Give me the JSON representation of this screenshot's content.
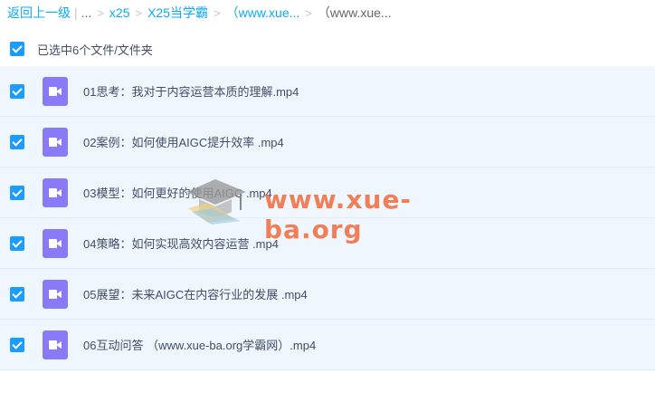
{
  "breadcrumb": {
    "back": "返回上一级",
    "ellipsis": "...",
    "items": [
      "x25",
      "X25当学霸",
      "（www.xue...",
      "（www.xue..."
    ]
  },
  "selection": {
    "label": "已选中6个文件/文件夹",
    "checked": true
  },
  "files": [
    {
      "name": "01思考：我对于内容运营本质的理解.mp4",
      "checked": true,
      "icon": "video-file-icon"
    },
    {
      "name": "02案例：如何使用AIGC提升效率 .mp4",
      "checked": true,
      "icon": "video-file-icon"
    },
    {
      "name": "03模型：如何更好的使用AIGC .mp4",
      "checked": true,
      "icon": "video-file-icon"
    },
    {
      "name": "04策略：如何实现高效内容运营 .mp4",
      "checked": true,
      "icon": "video-file-icon"
    },
    {
      "name": "05展望：未来AIGC在内容行业的发展 .mp4",
      "checked": true,
      "icon": "video-file-icon"
    },
    {
      "name": "06互动问答 （www.xue-ba.org学霸网）.mp4",
      "checked": true,
      "icon": "video-file-icon"
    }
  ],
  "watermark": {
    "text": "www.xue-ba.org"
  },
  "colors": {
    "accent": "#09aaff",
    "checkbox": "#1a9dff",
    "row_bg": "#f0f6fd",
    "video_icon": "#8a7af8",
    "watermark": "#f26a3a"
  }
}
